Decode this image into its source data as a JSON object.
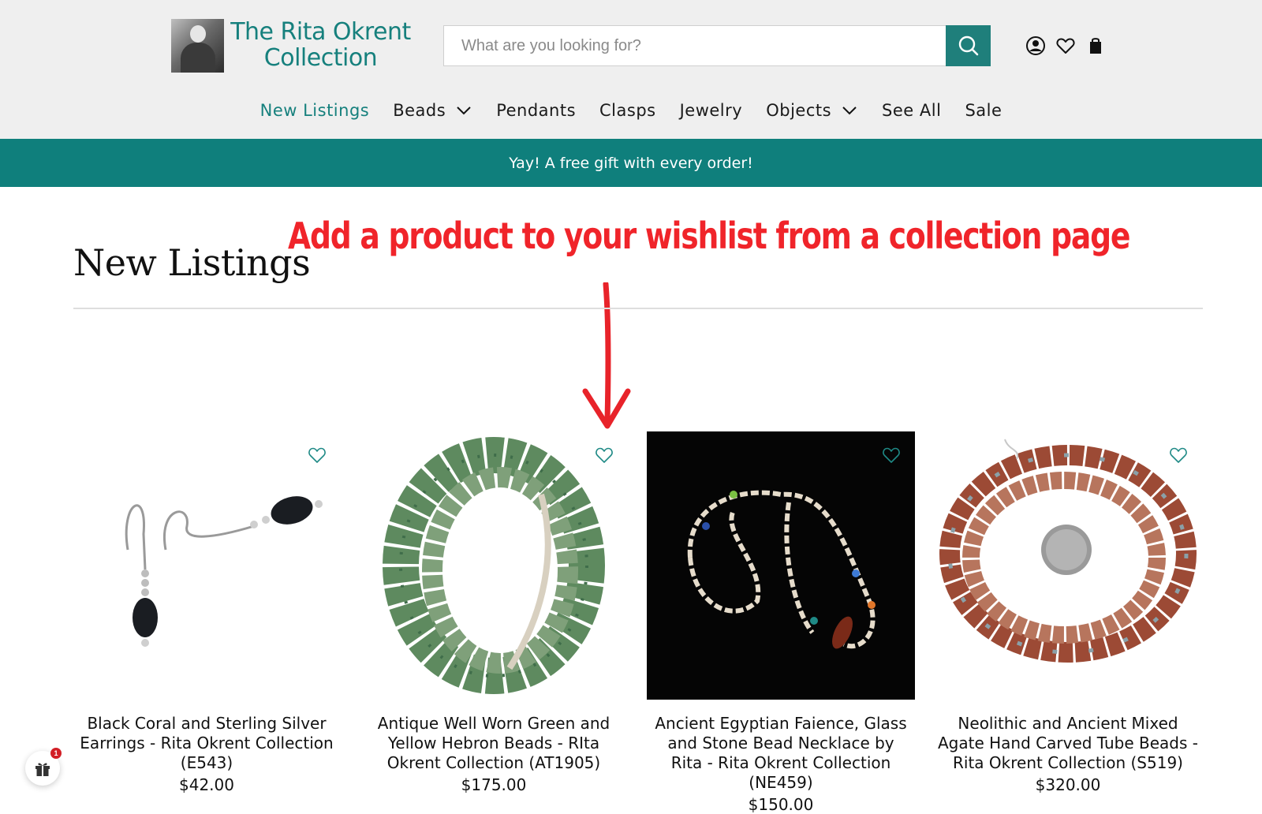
{
  "brand": {
    "name_line1": "The Rita Okrent",
    "name_line2": "Collection",
    "accent_color": "#16807d"
  },
  "search": {
    "placeholder": "What are you looking for?",
    "value": "",
    "button_icon": "search-icon"
  },
  "header_icons": [
    "account-icon",
    "wishlist-heart-icon",
    "cart-bag-icon"
  ],
  "nav": {
    "items": [
      {
        "label": "New Listings",
        "active": true
      },
      {
        "label": "Beads",
        "has_dropdown": true
      },
      {
        "label": "Pendants"
      },
      {
        "label": "Clasps"
      },
      {
        "label": "Jewelry"
      },
      {
        "label": "Objects",
        "has_dropdown": true
      },
      {
        "label": "See All"
      },
      {
        "label": "Sale"
      }
    ]
  },
  "banner": {
    "text": "Yay! A free gift with every order!",
    "color": "#0f7f7c"
  },
  "annotation": {
    "text": "Add a product to your wishlist from a collection page",
    "color": "#f0242a"
  },
  "page": {
    "title": "New Listings"
  },
  "products": [
    {
      "name": "Black Coral and Sterling Silver Earrings - Rita Okrent Collection (E543)",
      "price": "$42.00"
    },
    {
      "name": "Antique Well Worn Green and Yellow Hebron Beads - RIta Okrent Collection (AT1905)",
      "price": "$175.00"
    },
    {
      "name": "Ancient Egyptian Faience, Glass and Stone Bead Necklace by Rita - Rita Okrent Collection (NE459)",
      "price": "$150.00"
    },
    {
      "name": "Neolithic and Ancient Mixed Agate Hand Carved Tube Beads - Rita Okrent Collection (S519)",
      "price": "$320.00"
    }
  ],
  "gift_widget": {
    "badge_count": "1"
  }
}
